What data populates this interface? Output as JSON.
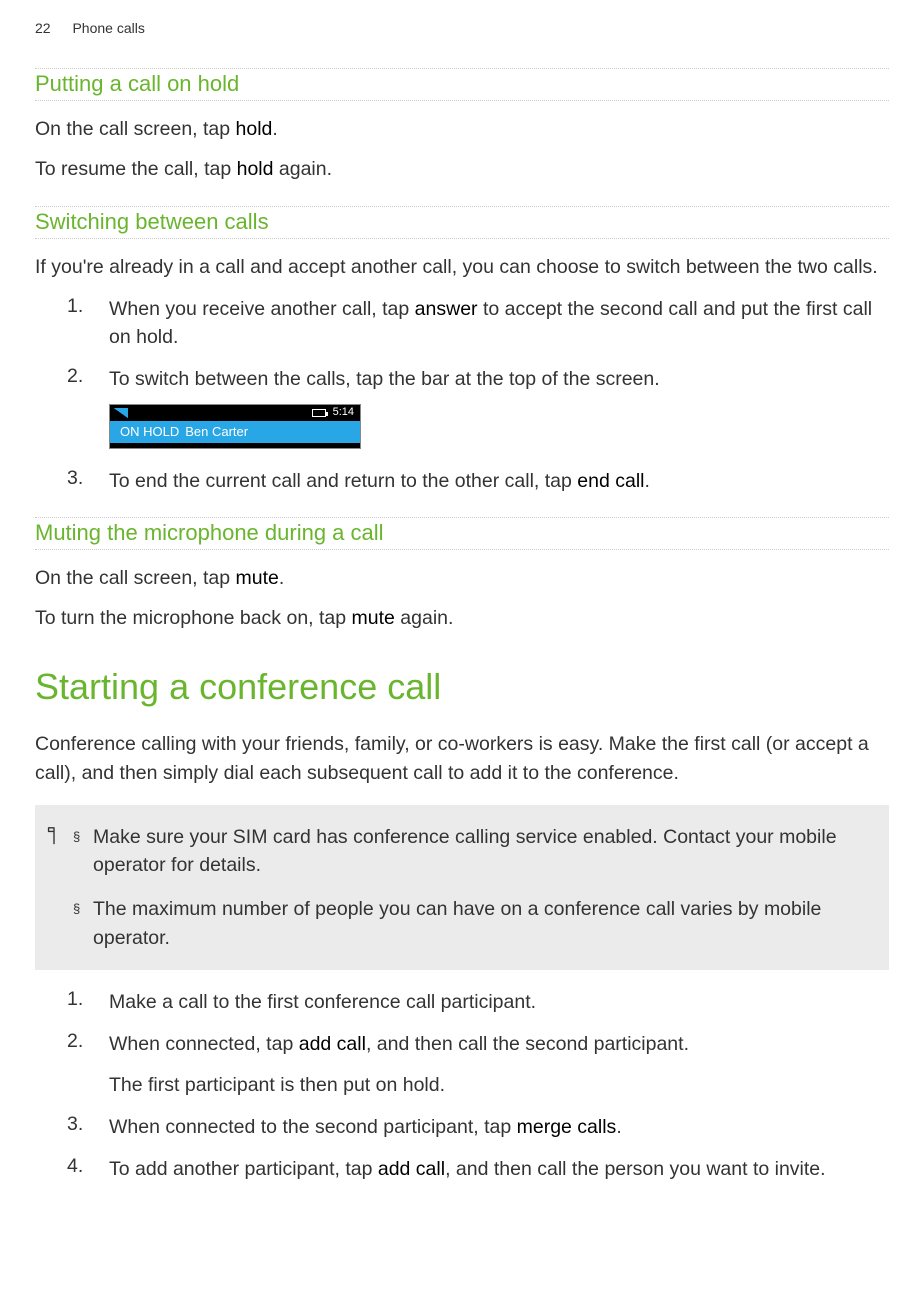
{
  "header": {
    "page_number": "22",
    "chapter": "Phone calls"
  },
  "s1": {
    "title": "Putting a call on hold",
    "p1_a": "On the call screen, tap ",
    "p1_b": "hold",
    "p1_c": ".",
    "p2_a": "To resume the call, tap ",
    "p2_b": "hold",
    "p2_c": " again."
  },
  "s2": {
    "title": "Switching between calls",
    "intro": "If you're already in a call and accept another call, you can choose to switch between the two calls.",
    "i1_a": "When you receive another call, tap ",
    "i1_b": "answer",
    "i1_c": " to accept the second call and put the first call on hold.",
    "i2": "To switch between the calls, tap the bar at the top of the screen.",
    "mock": {
      "time": "5:14",
      "hold_label": "ON HOLD",
      "name": "Ben Carter"
    },
    "i3_a": "To end the current call and return to the other call, tap ",
    "i3_b": "end call",
    "i3_c": "."
  },
  "s3": {
    "title": "Muting the microphone during a call",
    "p1_a": "On the call screen, tap ",
    "p1_b": "mute",
    "p1_c": ".",
    "p2_a": "To turn the microphone back on, tap ",
    "p2_b": "mute",
    "p2_c": " again."
  },
  "s4": {
    "title": "Starting a conference call",
    "intro": "Conference calling with your friends, family, or co-workers is easy. Make the first call (or accept a call), and then simply dial each subsequent call to add it to the conference.",
    "note1": "Make sure your SIM card has conference calling service enabled. Contact your mobile operator for details.",
    "note2": "The maximum number of people you can have on a conference call varies by mobile operator.",
    "i1": "Make a call to the first conference call participant.",
    "i2_a": "When connected, tap ",
    "i2_b": "add call",
    "i2_c": ", and then call the second participant.",
    "i2_sub": "The first participant is then put on hold.",
    "i3_a": "When connected to the second participant, tap ",
    "i3_b": "merge calls",
    "i3_c": ".",
    "i4_a": "To add another participant, tap ",
    "i4_b": "add call",
    "i4_c": ", and then call the person you want to invite."
  },
  "nums": {
    "n1": "1.",
    "n2": "2.",
    "n3": "3.",
    "n4": "4."
  },
  "bullet": "§"
}
